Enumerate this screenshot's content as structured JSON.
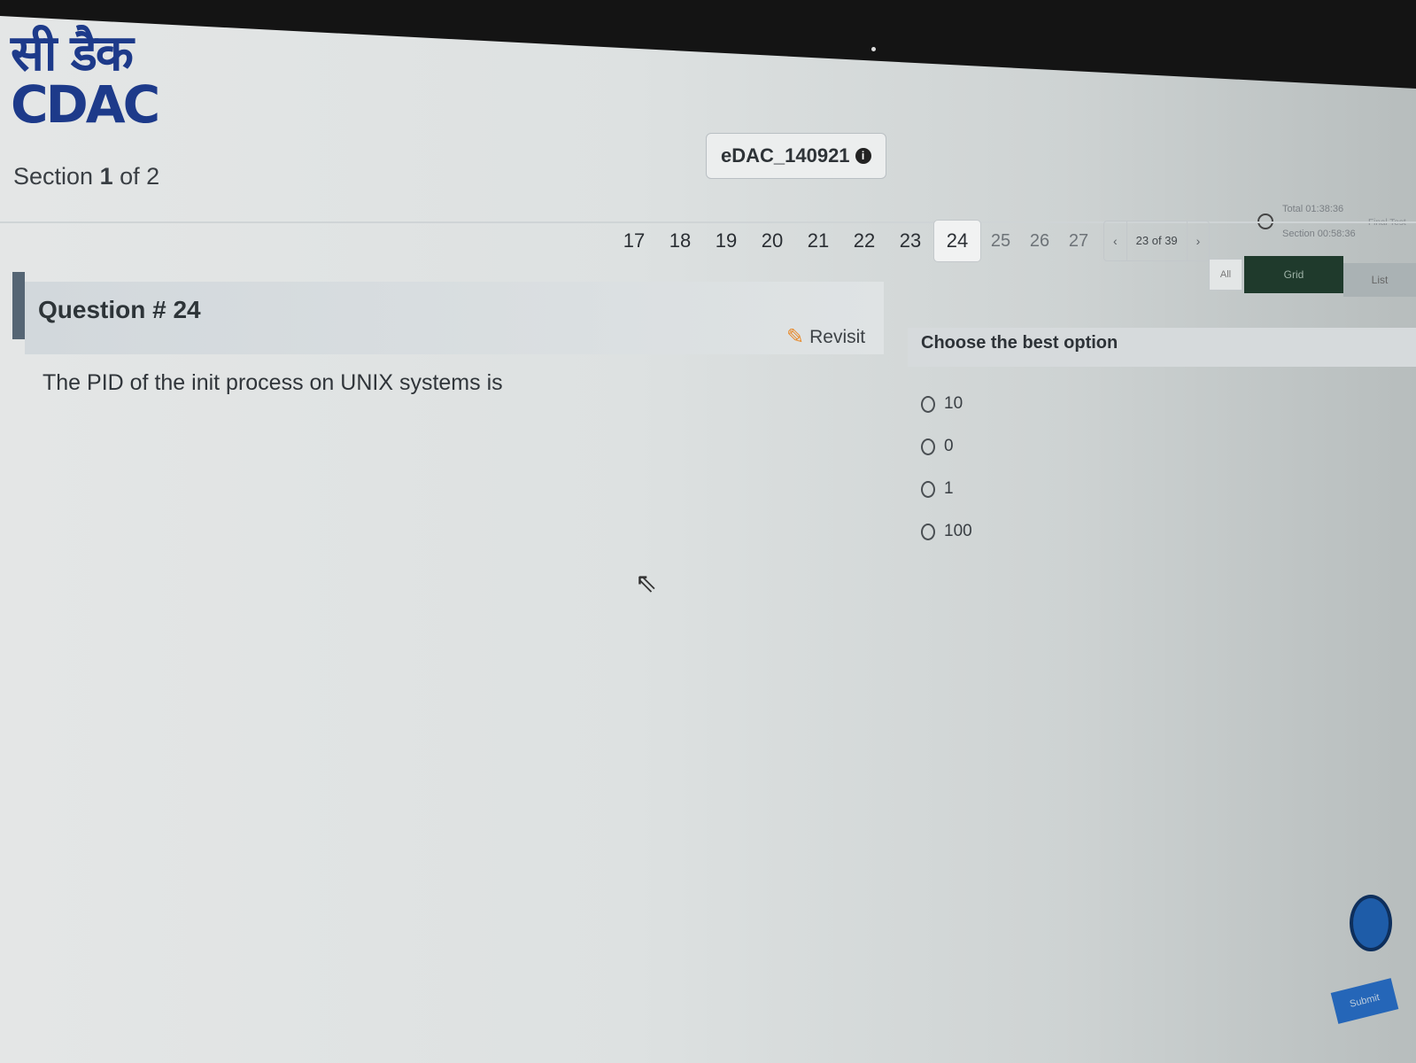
{
  "logo": {
    "hindi": "सी डैक",
    "name": "CDAC"
  },
  "section": {
    "prefix": "Section",
    "current": "1",
    "label_of": "of 2"
  },
  "test_id": "eDAC_140921",
  "timer": {
    "total": "Total 01:38:36",
    "section": "Section 00:58:36",
    "final_test": "Final Test"
  },
  "question_nav": {
    "numbers": [
      "17",
      "18",
      "19",
      "20",
      "21",
      "22",
      "23",
      "24",
      "25",
      "26",
      "27"
    ],
    "current": "24",
    "pager_prev": "‹",
    "pager_text": "23 of 39",
    "pager_next": "›"
  },
  "view_toggle": {
    "filter": "All",
    "grid": "Grid",
    "list": "List"
  },
  "question": {
    "title": "Question # 24",
    "revisit_label": "Revisit",
    "text": "The PID of the init process on UNIX systems is"
  },
  "answer": {
    "header": "Choose the best option",
    "options": [
      "10",
      "0",
      "1",
      "100"
    ]
  },
  "submit_label": "Submit"
}
